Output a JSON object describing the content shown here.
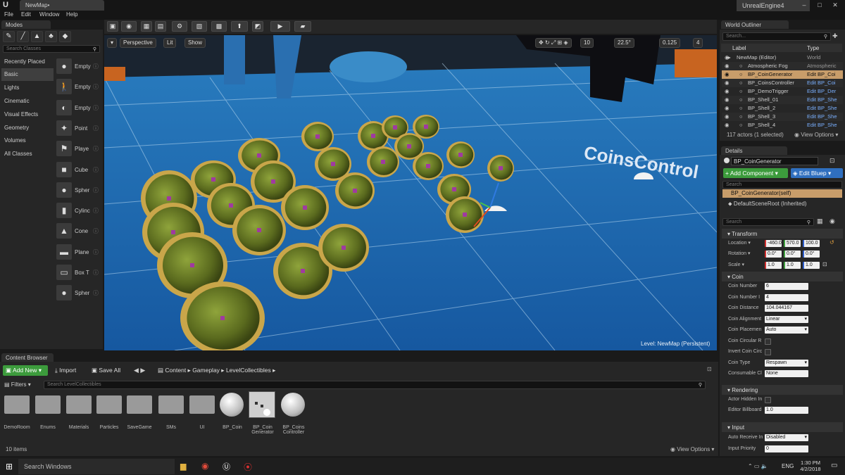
{
  "window": {
    "doc_tab": "NewMap•",
    "app_title": "UnrealEngine4",
    "controls": [
      "–",
      "□",
      "✕"
    ]
  },
  "menu": [
    "File",
    "Edit",
    "Window",
    "Help"
  ],
  "modes": {
    "tab": "Modes",
    "search_placeholder": "Search Classes",
    "categories": [
      "Recently Placed",
      "Basic",
      "Lights",
      "Cinematic",
      "Visual Effects",
      "Geometry",
      "Volumes",
      "All Classes"
    ],
    "active_category": "Basic",
    "items": [
      "Empty",
      "Empty",
      "Empty",
      "Point",
      "Playe",
      "Cube",
      "Spher",
      "Cylinc",
      "Cone",
      "Plane",
      "Box T",
      "Spher"
    ]
  },
  "viewport": {
    "perspective": "Perspective",
    "lit": "Lit",
    "show": "Show",
    "grid_snap": "10",
    "rot_snap": "22.5°",
    "scale_snap": "0.125",
    "cam_speed": "4",
    "level_label": "Level:",
    "level_name": "NewMap (Persistent)",
    "text_render": "CoinsControl"
  },
  "content_browser": {
    "tab": "Content Browser",
    "add_new": "Add New",
    "import": "Import",
    "save_all": "Save All",
    "path": [
      "Content",
      "Gameplay",
      "LevelCollectibles"
    ],
    "filters": "Filters",
    "search_placeholder": "Search LevelCollectibles",
    "assets": [
      "DemoRoom",
      "Enums",
      "Materials",
      "Particles",
      "SaveGame",
      "SMs",
      "UI",
      "BP_Coin",
      "BP_Coin Generator",
      "BP_Coins Controller"
    ],
    "item_count": "10 items",
    "view_options": "View Options"
  },
  "outliner": {
    "tab": "World Outliner",
    "search_placeholder": "Search...",
    "col_label": "Label",
    "col_type": "Type",
    "rows": [
      {
        "label": "NewMap (Editor)",
        "type": "World"
      },
      {
        "label": "Atmospheric Fog",
        "type": "Atmospheric"
      },
      {
        "label": "BP_CoinGenerator",
        "type": "Edit BP_Coi"
      },
      {
        "label": "BP_CoinsController",
        "type": "Edit BP_Coi"
      },
      {
        "label": "BP_DemoTrigger",
        "type": "Edit BP_Der"
      },
      {
        "label": "BP_Shell_01",
        "type": "Edit BP_She"
      },
      {
        "label": "BP_Shell_2",
        "type": "Edit BP_She"
      },
      {
        "label": "BP_Shell_3",
        "type": "Edit BP_She"
      },
      {
        "label": "BP_Shell_4",
        "type": "Edit BP_She"
      }
    ],
    "status": "117 actors (1 selected)",
    "view_options": "View Options"
  },
  "details": {
    "tab": "Details",
    "name": "BP_CoinGenerator",
    "add_component": "+ Add Component",
    "edit_blueprint": "Edit Bluep",
    "search_placeholder": "Search",
    "self_row": "BP_CoinGenerator(self)",
    "root_row": "DefaultSceneRoot (Inherited)",
    "search2_placeholder": "Search",
    "transform": {
      "header": "Transform",
      "location_label": "Location",
      "location": [
        "-460.0",
        "570.0",
        "100.0"
      ],
      "rotation_label": "Rotation",
      "rotation": [
        "0.0°",
        "0.0°",
        "0.0°"
      ],
      "scale_label": "Scale",
      "scale": [
        "1.0",
        "1.0",
        "1.0"
      ]
    },
    "coin": {
      "header": "Coin",
      "rows": [
        {
          "label": "Coin Number",
          "value": "6"
        },
        {
          "label": "Coin Number I",
          "value": "4"
        },
        {
          "label": "Coin Distance",
          "value": "104.044167"
        },
        {
          "label": "Coin Alignment",
          "value": "Linear"
        },
        {
          "label": "Coin Placemen",
          "value": "Auto"
        },
        {
          "label": "Coin Circular R",
          "value": ""
        },
        {
          "label": "Invert Coin Circ",
          "value": ""
        },
        {
          "label": "Coin Type",
          "value": "Respawn"
        },
        {
          "label": "Consumable Cl",
          "value": "None"
        }
      ]
    },
    "rendering": {
      "header": "Rendering",
      "rows": [
        {
          "label": "Actor Hidden In",
          "value": ""
        },
        {
          "label": "Editor Billboard",
          "value": "1.0"
        }
      ]
    },
    "input": {
      "header": "Input",
      "rows": [
        {
          "label": "Auto Receive In",
          "value": "Disabled"
        },
        {
          "label": "Input Priority",
          "value": "0"
        }
      ]
    }
  },
  "taskbar": {
    "search": "Search Windows",
    "lang": "ENG",
    "time": "1:30 PM",
    "date": "4/2/2018"
  }
}
